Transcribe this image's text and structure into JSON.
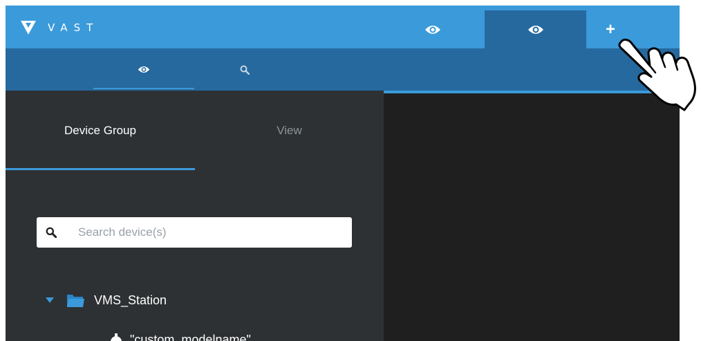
{
  "app": {
    "name": "VAST"
  },
  "top_tabs": [
    {
      "icon": "eye-icon",
      "active": false
    },
    {
      "icon": "eye-icon",
      "active": true
    }
  ],
  "add_tab": {
    "label": "+"
  },
  "sub_tabs": [
    {
      "icon": "eye-icon",
      "active": true
    },
    {
      "icon": "search-icon",
      "active": false
    }
  ],
  "panel": {
    "tabs": [
      {
        "label": "Device Group",
        "active": true
      },
      {
        "label": "View",
        "active": false
      }
    ],
    "search": {
      "placeholder": "Search device(s)",
      "value": ""
    },
    "tree": {
      "root": {
        "label": "VMS_Station",
        "expanded": true
      },
      "child": {
        "label": "\"custom_modelname\""
      }
    }
  },
  "colors": {
    "accent": "#3b9ad9",
    "subbar": "#26699f",
    "panel": "#2d3134",
    "content": "#1f1f1f",
    "folder": "#3b9ad9"
  }
}
